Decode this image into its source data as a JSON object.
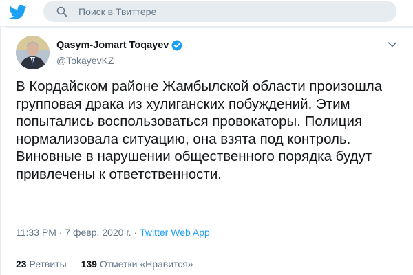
{
  "search": {
    "placeholder": "Поиск в Твиттере"
  },
  "tweet": {
    "author_name": "Qasym-Jomart Toqayev",
    "author_handle": "@TokayevKZ",
    "text": "В Кордайском районе Жамбылской области произошла групповая драка из хулиганских побуждений. Этим попытались воспользоваться провокаторы. Полиция нормализовала ситуацию, она взята под контроль. Виновные в нарушении общественного порядка будут привлечены к ответственности.",
    "time": "11:33 PM",
    "separator": "·",
    "date": "7 февр. 2020 г.",
    "source": "Twitter Web App",
    "retweets_count": "23",
    "retweets_label": "Ретвиты",
    "likes_count": "139",
    "likes_label": "Отметки «Нравится»"
  },
  "colors": {
    "brand": "#1da1f2",
    "secondary_text": "#657786",
    "search_bg": "#e6ecf0"
  },
  "icons": {
    "logo": "twitter-bird-icon",
    "search": "search-icon",
    "verified": "verified-badge-icon",
    "menu": "chevron-down-icon"
  }
}
